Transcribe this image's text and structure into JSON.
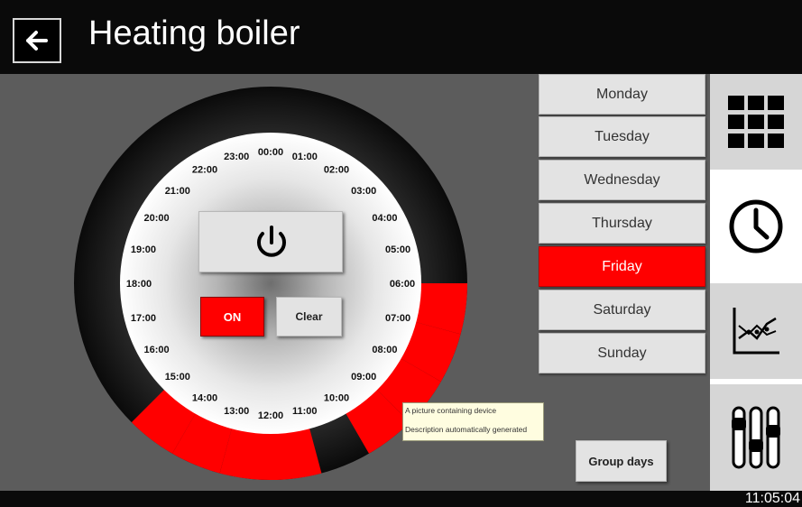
{
  "header": {
    "title": "Heating boiler",
    "back_icon": "back-arrow-icon"
  },
  "dial": {
    "hours": [
      "00:00",
      "01:00",
      "02:00",
      "03:00",
      "04:00",
      "05:00",
      "06:00",
      "07:00",
      "08:00",
      "09:00",
      "10:00",
      "11:00",
      "12:00",
      "13:00",
      "14:00",
      "15:00",
      "16:00",
      "17:00",
      "18:00",
      "19:00",
      "20:00",
      "21:00",
      "22:00",
      "23:00"
    ],
    "active_hours": [
      6,
      7,
      8,
      9,
      11,
      12,
      13,
      14
    ],
    "active_color": "#ff0000",
    "inactive_color": "#1a1a1a"
  },
  "controls": {
    "power_icon": "power-icon",
    "on_label": "ON",
    "clear_label": "Clear",
    "group_days_label": "Group days"
  },
  "days": [
    {
      "label": "Monday",
      "selected": false
    },
    {
      "label": "Tuesday",
      "selected": false
    },
    {
      "label": "Wednesday",
      "selected": false
    },
    {
      "label": "Thursday",
      "selected": false
    },
    {
      "label": "Friday",
      "selected": true
    },
    {
      "label": "Saturday",
      "selected": false
    },
    {
      "label": "Sunday",
      "selected": false
    }
  ],
  "tooltip": {
    "line1": "A picture containing device",
    "line2": "Description automatically generated"
  },
  "rail": [
    {
      "icon": "grid-icon",
      "active": false
    },
    {
      "icon": "clock-icon",
      "active": true
    },
    {
      "icon": "chart-icon",
      "active": false
    },
    {
      "icon": "sliders-icon",
      "active": false
    }
  ],
  "status": {
    "time": "11:05:04"
  },
  "colors": {
    "accent": "#ff0000",
    "background": "#5c5c5c"
  }
}
